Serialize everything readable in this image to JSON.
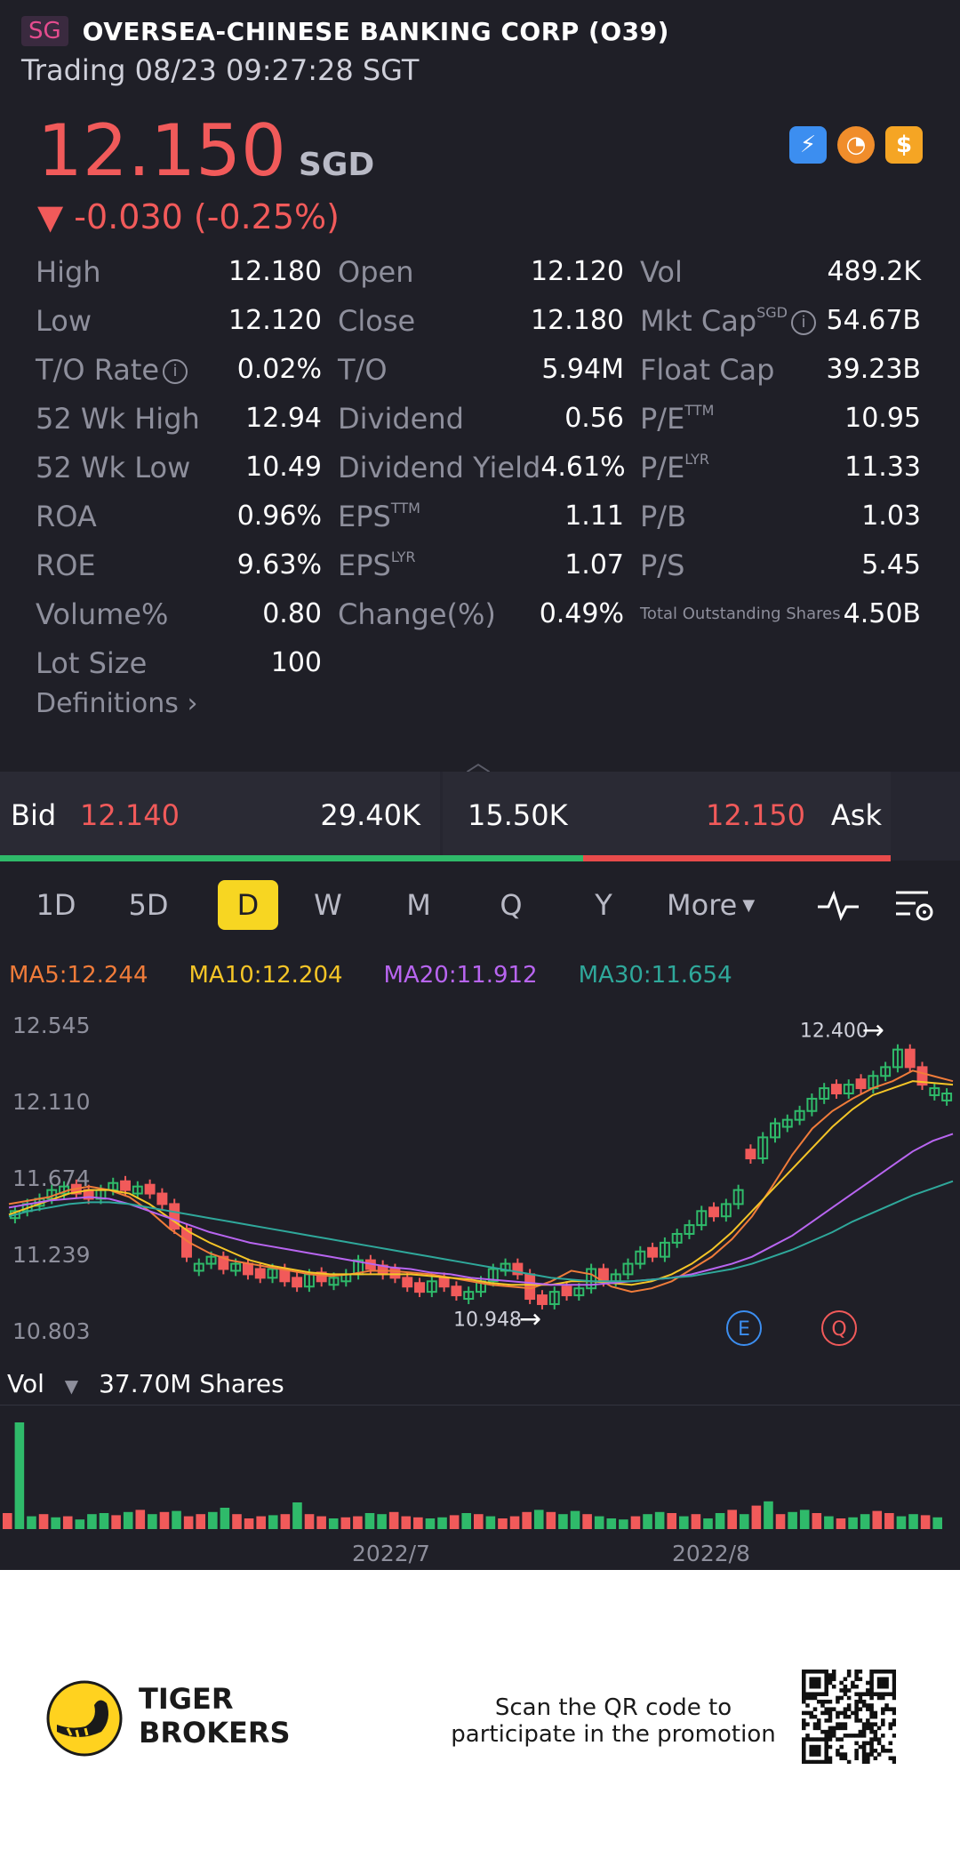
{
  "header": {
    "market_badge": "SG",
    "title": "OVERSEA-CHINESE BANKING CORP (O39)",
    "status": "Trading 08/23 09:27:28 SGT"
  },
  "quote": {
    "price": "12.150",
    "currency": "SGD",
    "change": "▼ -0.030 (-0.25%)",
    "badge_icons": [
      "lightning-icon",
      "gauge-icon",
      "dollar-icon"
    ]
  },
  "stats": [
    [
      {
        "label": "High",
        "value": "12.180"
      },
      {
        "label": "Open",
        "value": "12.120"
      },
      {
        "label": "Vol",
        "value": "489.2K"
      }
    ],
    [
      {
        "label": "Low",
        "value": "12.120"
      },
      {
        "label": "Close",
        "value": "12.180"
      },
      {
        "label": "Mkt Cap",
        "sup": "SGD",
        "info": true,
        "value": "54.67B"
      }
    ],
    [
      {
        "label": "T/O Rate",
        "info": true,
        "value": "0.02%"
      },
      {
        "label": "T/O",
        "value": "5.94M"
      },
      {
        "label": "Float Cap",
        "value": "39.23B"
      }
    ],
    [
      {
        "label": "52 Wk High",
        "value": "12.94"
      },
      {
        "label": "Dividend",
        "value": "0.56"
      },
      {
        "label": "P/E",
        "sup": "TTM",
        "value": "10.95"
      }
    ],
    [
      {
        "label": "52 Wk Low",
        "value": "10.49"
      },
      {
        "label": "Dividend Yield",
        "value": "4.61%"
      },
      {
        "label": "P/E",
        "sup": "LYR",
        "value": "11.33"
      }
    ],
    [
      {
        "label": "ROA",
        "value": "0.96%"
      },
      {
        "label": "EPS",
        "sup": "TTM",
        "value": "1.11"
      },
      {
        "label": "P/B",
        "value": "1.03"
      }
    ],
    [
      {
        "label": "ROE",
        "value": "9.63%"
      },
      {
        "label": "EPS",
        "sup": "LYR",
        "value": "1.07"
      },
      {
        "label": "P/S",
        "value": "5.45"
      }
    ],
    [
      {
        "label": "Volume%",
        "value": "0.80"
      },
      {
        "label": "Change(%)",
        "value": "0.49%"
      },
      {
        "label": "Total Outstanding Shares",
        "small": true,
        "value": "4.50B"
      }
    ],
    [
      {
        "label": "Lot Size",
        "value": "100"
      }
    ]
  ],
  "definitions_label": "Definitions",
  "bid_ask": {
    "bid_label": "Bid",
    "bid_price": "12.140",
    "bid_size": "29.40K",
    "ask_size": "15.50K",
    "ask_price": "12.150",
    "ask_label": "Ask",
    "bid_ratio": 0.655
  },
  "tabs": [
    "1D",
    "5D",
    "D",
    "W",
    "M",
    "Q",
    "Y",
    "More"
  ],
  "active_tab": "D",
  "ma": [
    {
      "label": "MA5:12.244",
      "color": "#f07c3a"
    },
    {
      "label": "MA10:12.204",
      "color": "#f5c527"
    },
    {
      "label": "MA20:11.912",
      "color": "#b865f0"
    },
    {
      "label": "MA30:11.654",
      "color": "#2fa89b"
    }
  ],
  "chart_data": {
    "type": "candlestick",
    "y_ticks": [
      "12.545",
      "12.110",
      "11.674",
      "11.239",
      "10.803"
    ],
    "ylim": [
      10.803,
      12.545
    ],
    "high_marker": "12.400",
    "low_marker": "10.948",
    "event_markers": [
      "E",
      "Q"
    ],
    "candles_close": [
      11.48,
      11.52,
      11.55,
      11.6,
      11.62,
      11.58,
      11.55,
      11.6,
      11.64,
      11.6,
      11.62,
      11.58,
      11.52,
      11.38,
      11.22,
      11.18,
      11.22,
      11.15,
      11.18,
      11.12,
      11.1,
      11.15,
      11.08,
      11.05,
      11.12,
      11.08,
      11.1,
      11.12,
      11.2,
      11.15,
      11.12,
      11.1,
      11.05,
      11.02,
      11.08,
      11.05,
      11.0,
      11.02,
      11.08,
      11.15,
      11.18,
      11.12,
      10.98,
      10.95,
      11.02,
      11.0,
      11.04,
      11.15,
      11.08,
      11.12,
      11.18,
      11.25,
      11.22,
      11.3,
      11.35,
      11.4,
      11.48,
      11.45,
      11.52,
      11.6,
      11.78,
      11.9,
      11.98,
      12.0,
      12.05,
      12.12,
      12.18,
      12.15,
      12.2,
      12.18,
      12.25,
      12.3,
      12.4,
      12.3,
      12.2,
      12.18,
      12.15
    ],
    "candles_up": [
      true,
      true,
      true,
      true,
      true,
      false,
      false,
      true,
      true,
      false,
      true,
      false,
      false,
      false,
      false,
      true,
      true,
      false,
      true,
      false,
      false,
      true,
      false,
      false,
      true,
      false,
      true,
      true,
      true,
      false,
      false,
      false,
      false,
      false,
      true,
      false,
      false,
      true,
      true,
      true,
      true,
      false,
      false,
      false,
      true,
      false,
      true,
      true,
      false,
      true,
      true,
      true,
      false,
      true,
      true,
      true,
      true,
      false,
      true,
      true,
      false,
      true,
      true,
      true,
      true,
      true,
      true,
      false,
      true,
      false,
      true,
      true,
      true,
      false,
      false,
      true,
      true
    ],
    "ma5": [
      11.52,
      11.54,
      11.56,
      11.6,
      11.62,
      11.6,
      11.56,
      11.48,
      11.38,
      11.3,
      11.24,
      11.2,
      11.18,
      11.16,
      11.14,
      11.12,
      11.11,
      11.12,
      11.14,
      11.14,
      11.13,
      11.12,
      11.1,
      11.08,
      11.06,
      11.05,
      11.04,
      11.08,
      11.14,
      11.12,
      11.05,
      11.02,
      11.04,
      11.08,
      11.15,
      11.22,
      11.32,
      11.45,
      11.62,
      11.8,
      11.95,
      12.05,
      12.12,
      12.18,
      12.22,
      12.28,
      12.25,
      12.22
    ],
    "ma10": [
      11.46,
      11.5,
      11.54,
      11.58,
      11.6,
      11.6,
      11.58,
      11.52,
      11.44,
      11.36,
      11.3,
      11.25,
      11.2,
      11.17,
      11.15,
      11.13,
      11.12,
      11.12,
      11.12,
      11.12,
      11.12,
      11.11,
      11.1,
      11.09,
      11.07,
      11.06,
      11.06,
      11.06,
      11.08,
      11.08,
      11.07,
      11.06,
      11.08,
      11.12,
      11.18,
      11.26,
      11.36,
      11.48,
      11.6,
      11.72,
      11.84,
      11.96,
      12.06,
      12.14,
      12.18,
      12.22,
      12.21,
      12.2
    ],
    "ma20": [
      11.5,
      11.52,
      11.54,
      11.55,
      11.56,
      11.55,
      11.52,
      11.48,
      11.44,
      11.4,
      11.36,
      11.33,
      11.3,
      11.28,
      11.26,
      11.24,
      11.22,
      11.2,
      11.18,
      11.16,
      11.15,
      11.13,
      11.12,
      11.1,
      11.09,
      11.08,
      11.07,
      11.06,
      11.06,
      11.06,
      11.07,
      11.08,
      11.09,
      11.1,
      11.12,
      11.15,
      11.18,
      11.22,
      11.28,
      11.34,
      11.42,
      11.5,
      11.58,
      11.66,
      11.74,
      11.82,
      11.88,
      11.92
    ],
    "ma30": [
      11.45,
      11.48,
      11.5,
      11.52,
      11.53,
      11.53,
      11.52,
      11.5,
      11.48,
      11.46,
      11.44,
      11.42,
      11.4,
      11.38,
      11.36,
      11.34,
      11.32,
      11.3,
      11.28,
      11.26,
      11.24,
      11.22,
      11.2,
      11.18,
      11.16,
      11.14,
      11.12,
      11.1,
      11.09,
      11.08,
      11.08,
      11.08,
      11.09,
      11.1,
      11.11,
      11.13,
      11.15,
      11.18,
      11.22,
      11.26,
      11.31,
      11.36,
      11.42,
      11.47,
      11.52,
      11.57,
      11.61,
      11.65
    ]
  },
  "volume": {
    "label": "Vol",
    "value": "37.70M Shares",
    "bars": [
      0.15,
      1.0,
      0.12,
      0.14,
      0.11,
      0.12,
      0.09,
      0.14,
      0.15,
      0.13,
      0.16,
      0.18,
      0.14,
      0.16,
      0.17,
      0.12,
      0.14,
      0.16,
      0.2,
      0.14,
      0.1,
      0.12,
      0.13,
      0.14,
      0.25,
      0.14,
      0.12,
      0.1,
      0.11,
      0.12,
      0.15,
      0.14,
      0.16,
      0.12,
      0.11,
      0.1,
      0.11,
      0.13,
      0.15,
      0.14,
      0.12,
      0.1,
      0.12,
      0.16,
      0.18,
      0.16,
      0.14,
      0.17,
      0.14,
      0.12,
      0.1,
      0.09,
      0.12,
      0.14,
      0.16,
      0.15,
      0.12,
      0.14,
      0.1,
      0.15,
      0.18,
      0.14,
      0.22,
      0.26,
      0.14,
      0.16,
      0.18,
      0.15,
      0.12,
      0.1,
      0.11,
      0.14,
      0.17,
      0.15,
      0.12,
      0.14,
      0.13,
      0.11
    ],
    "bars_up": [
      false,
      true,
      true,
      false,
      true,
      false,
      true,
      true,
      true,
      false,
      true,
      false,
      true,
      false,
      true,
      false,
      false,
      true,
      true,
      false,
      false,
      false,
      true,
      false,
      true,
      false,
      false,
      true,
      false,
      false,
      true,
      true,
      false,
      false,
      false,
      true,
      true,
      false,
      true,
      false,
      true,
      false,
      false,
      false,
      true,
      false,
      true,
      true,
      false,
      true,
      true,
      true,
      false,
      true,
      true,
      false,
      true,
      false,
      true,
      true,
      false,
      true,
      false,
      true,
      false,
      true,
      true,
      false,
      true,
      false,
      true,
      true,
      false,
      false,
      true,
      true,
      false,
      true
    ],
    "x_labels": [
      "2022/7",
      "2022/8"
    ]
  },
  "footer": {
    "brand_line1": "TIGER",
    "brand_line2": "BROKERS",
    "promo_line1": "Scan the QR code to",
    "promo_line2": "participate in the promotion"
  },
  "colors": {
    "up": "#2fba6a",
    "down": "#f15a5a",
    "accent": "#f7d622"
  }
}
